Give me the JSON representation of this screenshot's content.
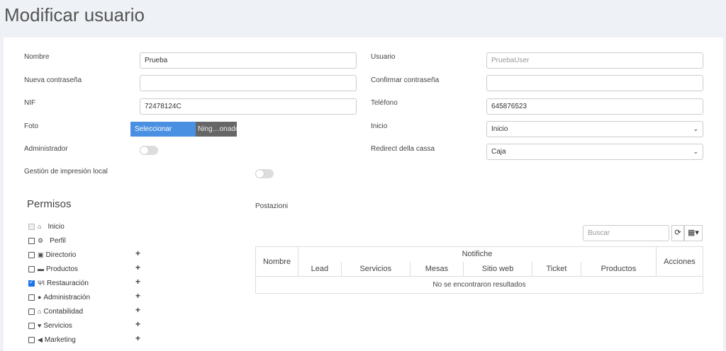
{
  "page": {
    "title": "Modificar usuario"
  },
  "form": {
    "nombre_label": "Nombre",
    "nombre_value": "Prueba",
    "usuario_label": "Usuario",
    "usuario_value": "PruebaUser",
    "nueva_pw_label": "Nueva contraseña",
    "confirmar_pw_label": "Confirmar contraseña",
    "nif_label": "NIF",
    "nif_value": "72478124C",
    "telefono_label": "Teléfono",
    "telefono_value": "645876523",
    "foto_label": "Foto",
    "file_button": "Seleccionar archivo",
    "file_name": "Ning…onado",
    "inicio_label": "Inicio",
    "inicio_value": "Inicio",
    "admin_label": "Administrador",
    "redirect_label": "Redirect della cassa",
    "redirect_value": "Caja",
    "gestion_label": "Gestión de impresión local"
  },
  "permisos": {
    "title": "Permisos",
    "items": [
      {
        "label": "Inicio",
        "icon": "home-icon",
        "state": "disabled",
        "expandable": false
      },
      {
        "label": "Perfil",
        "icon": "gear-icon",
        "state": "unchecked",
        "expandable": false
      },
      {
        "label": "Directorio",
        "icon": "address-book-icon",
        "state": "unchecked",
        "expandable": true
      },
      {
        "label": "Productos",
        "icon": "archive-icon",
        "state": "unchecked",
        "expandable": true
      },
      {
        "label": "Restauración",
        "icon": "cutlery-icon",
        "state": "checked",
        "expandable": true
      },
      {
        "label": "Administración",
        "icon": "user-icon",
        "state": "unchecked",
        "expandable": true
      },
      {
        "label": "Contabilidad",
        "icon": "bank-icon",
        "state": "unchecked",
        "expandable": true
      },
      {
        "label": "Servicios",
        "icon": "heart-icon",
        "state": "unchecked",
        "expandable": true
      },
      {
        "label": "Marketing",
        "icon": "megaphone-icon",
        "state": "unchecked",
        "expandable": true
      }
    ]
  },
  "postazioni": {
    "title": "Postazioni",
    "search_placeholder": "Buscar",
    "group_header": "Notifiche",
    "columns": [
      "Nombre",
      "Lead",
      "Servicios",
      "Mesas",
      "Sitio web",
      "Ticket",
      "Productos",
      "Acciones"
    ],
    "empty_message": "No se encontraron resultados"
  }
}
